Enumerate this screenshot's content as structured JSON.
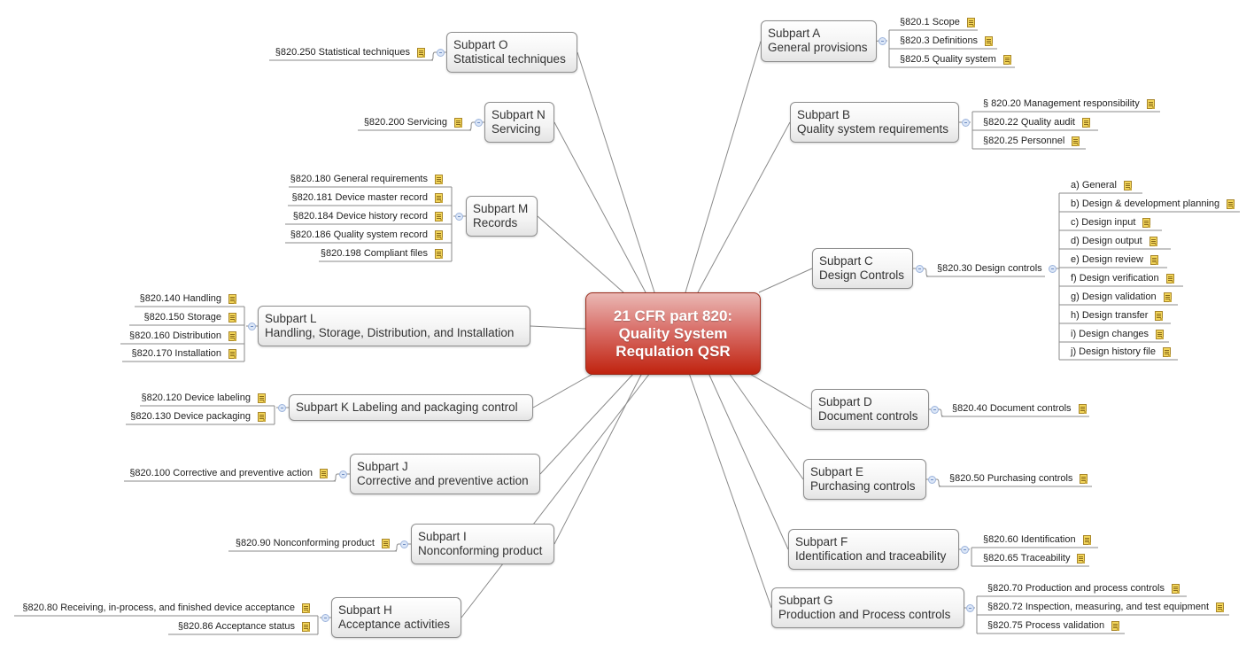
{
  "central": {
    "lines": [
      "21 CFR part 820:",
      "Quality System",
      "Requlation QSR"
    ],
    "color": "#c0230f"
  },
  "note_icon": "note-icon",
  "collapse_icon": "collapse-minus-icon",
  "subparts": [
    {
      "id": "a",
      "title": "Subpart A",
      "subtitle": "General provisions",
      "sections": [
        "§820.1 Scope",
        "§820.3 Definitions",
        "§820.5 Quality system"
      ]
    },
    {
      "id": "b",
      "title": "Subpart B",
      "subtitle": "Quality system requirements",
      "sections": [
        "§ 820.20 Management responsibility",
        "§820.22 Quality audit",
        "§820.25 Personnel"
      ]
    },
    {
      "id": "c",
      "title": "Subpart C",
      "subtitle": "Design Controls",
      "sections": [
        "§820.30 Design controls"
      ],
      "subsections": [
        "a) General",
        "b) Design & development planning",
        "c) Design input",
        "d) Design output",
        "e) Design review",
        "f) Design verification",
        "g) Design validation",
        "h) Design transfer",
        "i) Design changes",
        "j) Design history file"
      ]
    },
    {
      "id": "d",
      "title": "Subpart D",
      "subtitle": "Document controls",
      "sections": [
        "§820.40 Document controls"
      ]
    },
    {
      "id": "e",
      "title": "Subpart E",
      "subtitle": "Purchasing controls",
      "sections": [
        "§820.50 Purchasing controls"
      ]
    },
    {
      "id": "f",
      "title": "Subpart F",
      "subtitle": "Identification and traceability",
      "sections": [
        "§820.60 Identification",
        "§820.65 Traceability"
      ]
    },
    {
      "id": "g",
      "title": "Subpart G",
      "subtitle": "Production and Process controls",
      "sections": [
        "§820.70 Production and process controls",
        "§820.72 Inspection, measuring, and test equipment",
        "§820.75 Process validation"
      ]
    },
    {
      "id": "h",
      "title": "Subpart H",
      "subtitle": "Acceptance activities",
      "sections": [
        "§820.80 Receiving, in-process, and finished device acceptance",
        "§820.86 Acceptance status"
      ]
    },
    {
      "id": "i",
      "title": "Subpart I",
      "subtitle": "Nonconforming product",
      "sections": [
        "§820.90 Nonconforming product"
      ]
    },
    {
      "id": "j",
      "title": "Subpart J",
      "subtitle": "Corrective and preventive action",
      "sections": [
        "§820.100 Corrective and preventive action"
      ]
    },
    {
      "id": "k",
      "title": "Subpart K Labeling and packaging control",
      "subtitle": "",
      "sections": [
        "§820.120 Device labeling",
        "§820.130 Device packaging"
      ]
    },
    {
      "id": "l",
      "title": "Subpart L",
      "subtitle": "Handling, Storage, Distribution, and Installation",
      "sections": [
        "§820.140 Handling",
        "§820.150 Storage",
        "§820.160 Distribution",
        "§820.170 Installation"
      ]
    },
    {
      "id": "m",
      "title": "Subpart M",
      "subtitle": "Records",
      "sections": [
        "§820.180 General requirements",
        "§820.181 Device master record",
        "§820.184 Device history record",
        "§820.186 Quality system record",
        "§820.198 Compliant files"
      ]
    },
    {
      "id": "n",
      "title": "Subpart N",
      "subtitle": "Servicing",
      "sections": [
        "§820.200 Servicing"
      ]
    },
    {
      "id": "o",
      "title": "Subpart O",
      "subtitle": "Statistical techniques",
      "sections": [
        "§820.250 Statistical techniques"
      ]
    }
  ]
}
